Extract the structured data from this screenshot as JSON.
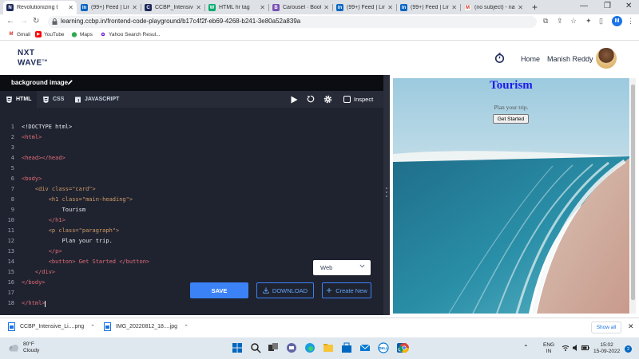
{
  "browser": {
    "tabs": [
      {
        "title": "Revolutionizing t",
        "icon": "nxtwave-favicon-icon",
        "active": true
      },
      {
        "title": "(99+) Feed | Linke",
        "icon": "linkedin-icon"
      },
      {
        "title": "CCBP_Intensive_L",
        "icon": "ccbp-favicon-icon"
      },
      {
        "title": "HTML hr tag",
        "icon": "w3schools-icon"
      },
      {
        "title": "Carousel · Bootstr",
        "icon": "bootstrap-icon"
      },
      {
        "title": "(99+) Feed | Linke",
        "icon": "linkedin-icon"
      },
      {
        "title": "(99+) Feed | Linke",
        "icon": "linkedin-icon"
      },
      {
        "title": "(no subject) - nav",
        "icon": "gmail-icon"
      }
    ],
    "url": "learning.ccbp.in/frontend-code-playground/b17c4f2f-eb69-4268-b241-3e80a52a839a",
    "profile_initial": "M",
    "bookmarks": [
      {
        "label": "Gmail",
        "icon": "gmail-icon"
      },
      {
        "label": "YouTube",
        "icon": "youtube-icon"
      },
      {
        "label": "Maps",
        "icon": "maps-icon"
      },
      {
        "label": "Yahoo Search Resul...",
        "icon": "yahoo-icon"
      }
    ]
  },
  "site": {
    "logo_line1": "NXT",
    "logo_line2": "WAVE",
    "logo_tm": "TM",
    "nav_home": "Home",
    "user_name": "Manish Reddy"
  },
  "editor": {
    "title": "background image",
    "tabs": [
      {
        "label": "HTML",
        "active": true
      },
      {
        "label": "CSS",
        "active": false
      },
      {
        "label": "JAVASCRIPT",
        "active": false
      }
    ],
    "inspect_label": "Inspect",
    "mode_value": "Web",
    "save_label": "SAVE",
    "download_label": "DOWNLOAD",
    "create_label": "Create New",
    "code_lines": [
      "<!DOCTYPE html>",
      "<html>",
      "",
      "<head></head>",
      "",
      "<body>",
      "    <div class=\"card\">",
      "        <h1 class=\"main-heading\">",
      "            Tourism",
      "        </h1>",
      "        <p class=\"paragraph\">",
      "            Plan your trip.",
      "        </p>",
      "        <button> Get Started </button>",
      "    </div>",
      "</body>",
      "",
      "</html>"
    ]
  },
  "preview": {
    "heading": "Tourism",
    "paragraph": "Plan your trip.",
    "button": "Get Started"
  },
  "downloads": [
    {
      "name": "CCBP_Intensive_Li....png"
    },
    {
      "name": "IMG_20220812_18....jpg"
    }
  ],
  "downloads_show_all": "Show all",
  "taskbar": {
    "temp": "80°F",
    "condition": "Cloudy",
    "lang_line1": "ENG",
    "lang_line2": "IN",
    "time": "15:02",
    "date": "15-09-2022",
    "notifications": "2"
  }
}
